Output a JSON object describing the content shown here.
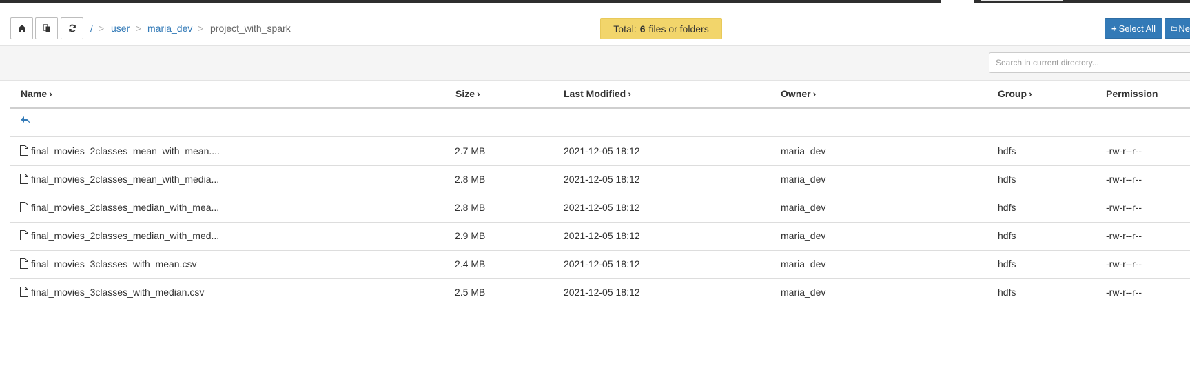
{
  "toolbar": {
    "buttons": [
      {
        "icon": "home-icon"
      },
      {
        "icon": "copy-icon"
      },
      {
        "icon": "refresh-icon"
      }
    ]
  },
  "breadcrumb": {
    "root": "/",
    "separator": ">",
    "items": [
      "user",
      "maria_dev"
    ],
    "current": "project_with_spark"
  },
  "summary": {
    "prefix": "Total:",
    "count": "6",
    "suffix": "files or folders"
  },
  "actions": {
    "select_all": "Select All",
    "new": "Ne"
  },
  "search": {
    "placeholder": "Search in current directory...",
    "value": ""
  },
  "table": {
    "columns": [
      "Name",
      "Size",
      "Last Modified",
      "Owner",
      "Group",
      "Permission"
    ],
    "up_icon": "reply-arrow-icon",
    "rows": [
      {
        "name": "final_movies_2classes_mean_with_mean....",
        "size": "2.7 MB",
        "modified": "2021-12-05 18:12",
        "owner": "maria_dev",
        "group": "hdfs",
        "permission": "-rw-r--r--"
      },
      {
        "name": "final_movies_2classes_mean_with_media...",
        "size": "2.8 MB",
        "modified": "2021-12-05 18:12",
        "owner": "maria_dev",
        "group": "hdfs",
        "permission": "-rw-r--r--"
      },
      {
        "name": "final_movies_2classes_median_with_mea...",
        "size": "2.8 MB",
        "modified": "2021-12-05 18:12",
        "owner": "maria_dev",
        "group": "hdfs",
        "permission": "-rw-r--r--"
      },
      {
        "name": "final_movies_2classes_median_with_med...",
        "size": "2.9 MB",
        "modified": "2021-12-05 18:12",
        "owner": "maria_dev",
        "group": "hdfs",
        "permission": "-rw-r--r--"
      },
      {
        "name": "final_movies_3classes_with_mean.csv",
        "size": "2.4 MB",
        "modified": "2021-12-05 18:12",
        "owner": "maria_dev",
        "group": "hdfs",
        "permission": "-rw-r--r--"
      },
      {
        "name": "final_movies_3classes_with_median.csv",
        "size": "2.5 MB",
        "modified": "2021-12-05 18:12",
        "owner": "maria_dev",
        "group": "hdfs",
        "permission": "-rw-r--r--"
      }
    ]
  },
  "colors": {
    "accent": "#337ab7",
    "badge": "#f2d56b",
    "topbar": "#2f2f2f"
  }
}
